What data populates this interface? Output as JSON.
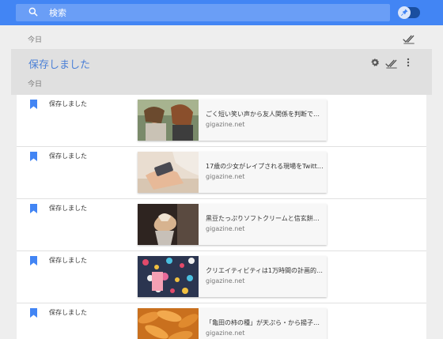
{
  "search": {
    "placeholder": "検索"
  },
  "date_header": {
    "label": "今日"
  },
  "card": {
    "title": "保存しました",
    "date": "今日"
  },
  "items": [
    {
      "label": "保存しました",
      "title": "ごく短い笑い声から友人関係を判断できるこ…",
      "domain": "gigazine.net",
      "thumb_desc": "two women laughing"
    },
    {
      "label": "保存しました",
      "title": "17歳の少女がレイプされる現場をTwitterの…",
      "domain": "gigazine.net",
      "thumb_desc": "phone in hand"
    },
    {
      "label": "保存しました",
      "title": "黒豆たっぷりソフトクリームと信玄餅をコラ…",
      "domain": "gigazine.net",
      "thumb_desc": "soft serve ice cream"
    },
    {
      "label": "保存しました",
      "title": "クリエイティビティは1万時間の計画的な練…",
      "domain": "gigazine.net",
      "thumb_desc": "colorful hanging decorations"
    },
    {
      "label": "保存しました",
      "title": "「亀田の柿の種」が天ぷら・から揚子・雑製…",
      "domain": "gigazine.net",
      "thumb_desc": "fried food"
    }
  ],
  "colors": {
    "topbar": "#4285f4",
    "accent": "#4a7fd6"
  }
}
